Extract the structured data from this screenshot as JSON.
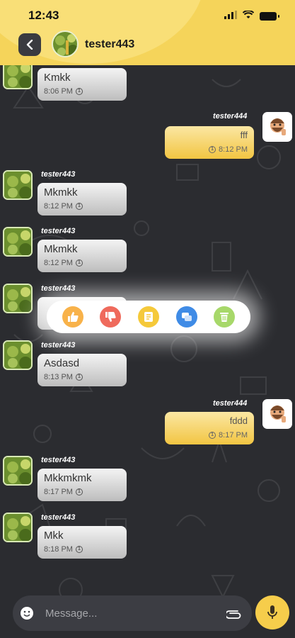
{
  "status_bar": {
    "time": "12:43"
  },
  "header": {
    "contact_name": "tester443"
  },
  "colors": {
    "header_bg": "#f5d45a",
    "chat_bg": "#2b2c30",
    "outgoing_bubble": "#f2c542",
    "incoming_bubble": "#d6d6d6",
    "mic_button": "#f6cd4b"
  },
  "messages": [
    {
      "direction": "in",
      "sender": "",
      "text": "Kmkk",
      "time": "8:06 PM"
    },
    {
      "direction": "out",
      "sender": "tester444",
      "text": "fff",
      "time": "8:12 PM"
    },
    {
      "direction": "in",
      "sender": "tester443",
      "text": "Mkmkk",
      "time": "8:12 PM"
    },
    {
      "direction": "in",
      "sender": "tester443",
      "text": "Mkmkk",
      "time": "8:12 PM"
    },
    {
      "direction": "in",
      "sender": "tester443",
      "text": "",
      "time": ""
    },
    {
      "direction": "in",
      "sender": "tester443",
      "text": "Asdasd",
      "time": "8:13 PM"
    },
    {
      "direction": "out",
      "sender": "tester444",
      "text": "fddd",
      "time": "8:17 PM"
    },
    {
      "direction": "in",
      "sender": "tester443",
      "text": "Mkkmkmk",
      "time": "8:17 PM"
    },
    {
      "direction": "in",
      "sender": "tester443",
      "text": "Mkk",
      "time": "8:18 PM"
    }
  ],
  "reaction_menu": [
    {
      "icon": "thumbs-up-icon"
    },
    {
      "icon": "thumbs-down-icon"
    },
    {
      "icon": "note-icon"
    },
    {
      "icon": "chat-icon"
    },
    {
      "icon": "trash-icon"
    }
  ],
  "composer": {
    "placeholder": "Message..."
  }
}
